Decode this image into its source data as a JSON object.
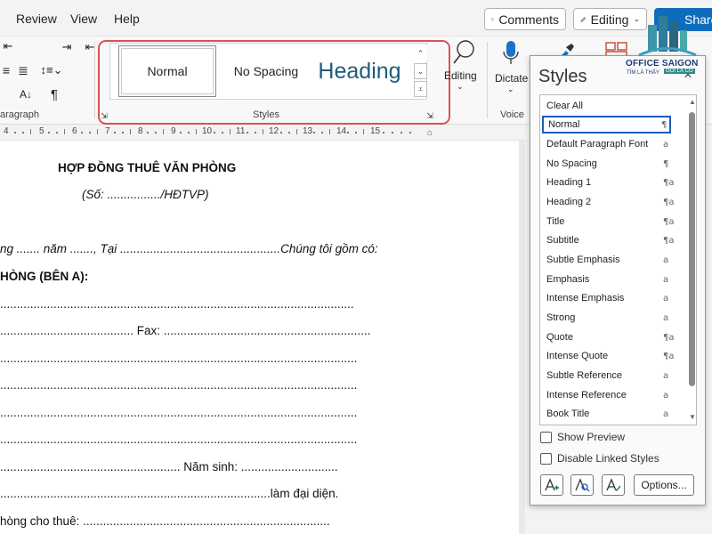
{
  "menubar": {
    "items": [
      "Review",
      "View",
      "Help"
    ],
    "comments_label": "Comments",
    "editing_label": "Editing",
    "share_label": "Share"
  },
  "ribbon": {
    "paragraph_group_label": "aragraph",
    "styles_group_label": "Styles",
    "editing_label": "Editing",
    "dictate_label": "Dictate",
    "voice_group_label": "Voice",
    "gallery": {
      "normal": "Normal",
      "no_spacing": "No Spacing",
      "heading": "Heading"
    }
  },
  "ruler": {
    "numbers": [
      "4",
      "5",
      "6",
      "7",
      "8",
      "9",
      "10",
      "11",
      "12",
      "13",
      "14",
      "15"
    ]
  },
  "document": {
    "title": "HỢP ĐỒNG THUÊ VĂN PHÒNG",
    "number_line": "(Số: ................/HĐTVP)",
    "date_line": "ng ....... năm ......., Tại ................................................Chúng tôi gồm có:",
    "party_a": "HÒNG (BÊN A):",
    "line1": "..........................................................................................................",
    "line2": "........................................ Fax: ..............................................................",
    "line3": "...........................................................................................................",
    "line4": "...........................................................................................................",
    "line5": "...........................................................................................................",
    "line6": "...........................................................................................................",
    "line7": "...................................................... Năm sinh: .............................",
    "line8": ".................................................................................làm đại diện.",
    "line9": "hòng cho thuê: .........................................................................."
  },
  "styles_pane": {
    "title": "Styles",
    "items": [
      {
        "label": "Clear All",
        "icon": ""
      },
      {
        "label": "Normal",
        "icon": "¶"
      },
      {
        "label": "Default Paragraph Font",
        "icon": "a"
      },
      {
        "label": "No Spacing",
        "icon": "¶"
      },
      {
        "label": "Heading 1",
        "icon": "¶a"
      },
      {
        "label": "Heading 2",
        "icon": "¶a"
      },
      {
        "label": "Title",
        "icon": "¶a"
      },
      {
        "label": "Subtitle",
        "icon": "¶a"
      },
      {
        "label": "Subtle Emphasis",
        "icon": "a"
      },
      {
        "label": "Emphasis",
        "icon": "a"
      },
      {
        "label": "Intense Emphasis",
        "icon": "a"
      },
      {
        "label": "Strong",
        "icon": "a"
      },
      {
        "label": "Quote",
        "icon": "¶a"
      },
      {
        "label": "Intense Quote",
        "icon": "¶a"
      },
      {
        "label": "Subtle Reference",
        "icon": "a"
      },
      {
        "label": "Intense Reference",
        "icon": "a"
      },
      {
        "label": "Book Title",
        "icon": "a"
      }
    ],
    "selected": "Normal",
    "show_preview_label": "Show Preview",
    "disable_linked_label": "Disable Linked Styles",
    "options_label": "Options..."
  },
  "logo": {
    "name": "OFFICE SAIGON",
    "tagline": "TÌM LÀ THẤY",
    "badge": "GỌI LÀ CÓ"
  },
  "colors": {
    "accent": "#0f6cbd",
    "highlight_border": "#d9534f",
    "heading_style": "#1f5c7a"
  }
}
